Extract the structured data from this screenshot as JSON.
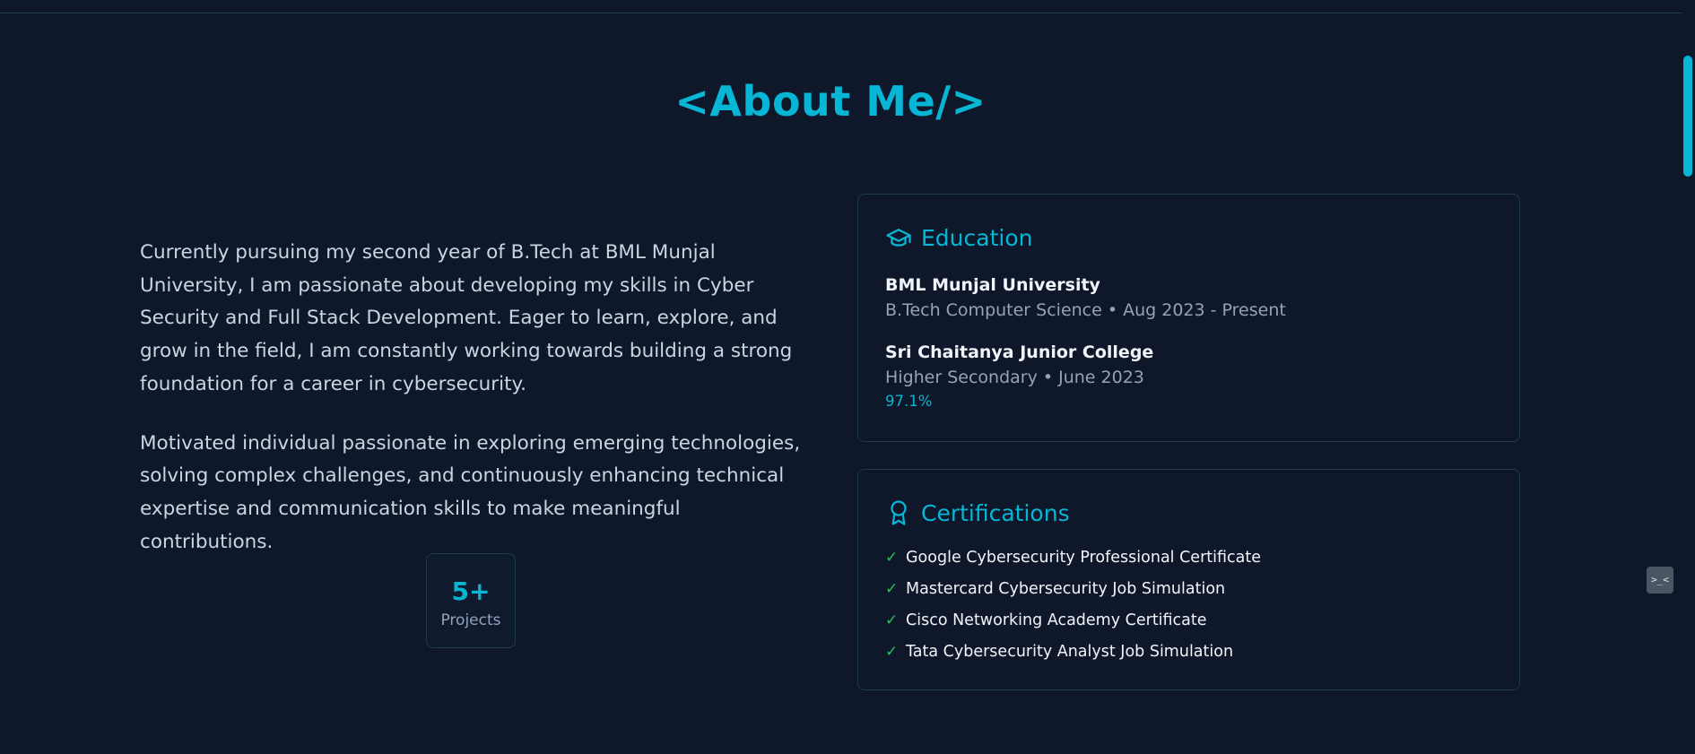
{
  "section": {
    "title": "<About Me/>"
  },
  "about": {
    "paragraphs": [
      "Currently pursuing my second year of B.Tech at BML Munjal University, I am passionate about developing my skills in Cyber Security and Full Stack Development. Eager to learn, explore, and grow in the field, I am constantly working towards building a strong foundation for a career in cybersecurity.",
      "Motivated individual passionate in exploring emerging technologies, solving complex challenges, and continuously enhancing technical expertise and communication skills to make meaningful contributions."
    ],
    "stat": {
      "value": "5+",
      "label": "Projects"
    }
  },
  "education": {
    "title": "Education",
    "icon": "graduation-cap-icon",
    "items": [
      {
        "name": "BML Munjal University",
        "detail": "B.Tech Computer Science • Aug 2023 - Present",
        "grade": ""
      },
      {
        "name": "Sri Chaitanya Junior College",
        "detail": "Higher Secondary • June 2023",
        "grade": "97.1%"
      }
    ]
  },
  "certifications": {
    "title": "Certifications",
    "icon": "award-icon",
    "check_glyph": "✓",
    "items": [
      "Google Cybersecurity Professional Certificate",
      "Mastercard Cybersecurity Job Simulation",
      "Cisco Networking Academy Certificate",
      "Tata Cybersecurity Analyst Job Simulation"
    ]
  },
  "floating_button": {
    "label": ">_<",
    "icon": "terminal-icon"
  },
  "colors": {
    "background": "#0f172a",
    "accent": "#06b6d4",
    "check": "#22c55e",
    "border": "#1e3a4c"
  }
}
